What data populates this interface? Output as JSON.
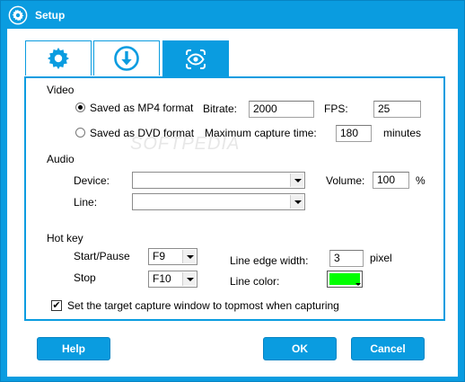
{
  "window": {
    "title": "Setup"
  },
  "tabs": [
    {
      "icon": "gear-icon",
      "active": false
    },
    {
      "icon": "download-icon",
      "active": false
    },
    {
      "icon": "eye-icon",
      "active": true
    }
  ],
  "video": {
    "heading": "Video",
    "mp4_label": "Saved as MP4 format",
    "dvd_label": "Saved as DVD format",
    "selected": "mp4",
    "bitrate_label": "Bitrate:",
    "bitrate_value": "2000",
    "fps_label": "FPS:",
    "fps_value": "25",
    "max_time_label": "Maximum capture time:",
    "max_time_value": "180",
    "minutes_label": "minutes"
  },
  "audio": {
    "heading": "Audio",
    "device_label": "Device:",
    "device_value": "",
    "line_label": "Line:",
    "line_value": "",
    "volume_label": "Volume:",
    "volume_value": "100",
    "percent_label": "%"
  },
  "hotkey": {
    "heading": "Hot key",
    "start_pause_label": "Start/Pause",
    "start_pause_value": "F9",
    "stop_label": "Stop",
    "stop_value": "F10",
    "line_edge_label": "Line edge width:",
    "line_edge_value": "3",
    "pixel_label": "pixel",
    "line_color_label": "Line color:",
    "line_color": "#00ff00"
  },
  "topmost": {
    "label": "Set the target capture window to topmost when capturing",
    "checked": true,
    "mark": "✔"
  },
  "buttons": {
    "help": "Help",
    "ok": "OK",
    "cancel": "Cancel"
  },
  "colors": {
    "accent": "#0a9ce0",
    "line_color": "#00ff00"
  }
}
